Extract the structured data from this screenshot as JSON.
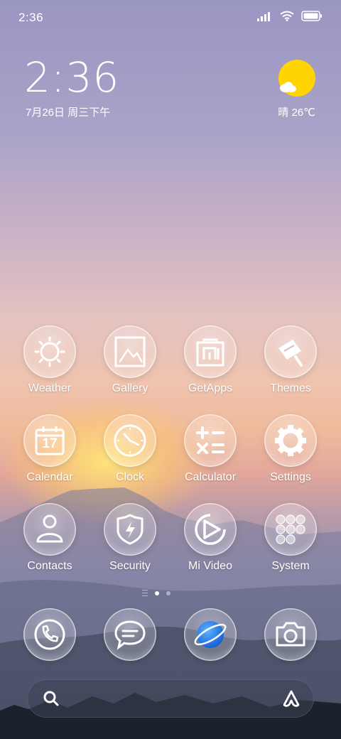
{
  "status_bar": {
    "time": "2:36"
  },
  "clock_widget": {
    "time": "2:36",
    "date": "7月26日 周三下午",
    "weather": "晴 26℃"
  },
  "apps": [
    {
      "label": "Weather",
      "icon": "sun-icon"
    },
    {
      "label": "Gallery",
      "icon": "picture-icon"
    },
    {
      "label": "GetApps",
      "icon": "shopping-bag-icon"
    },
    {
      "label": "Themes",
      "icon": "paint-roller-icon"
    },
    {
      "label": "Calendar",
      "icon": "calendar-icon",
      "day": "17"
    },
    {
      "label": "Clock",
      "icon": "clock-icon"
    },
    {
      "label": "Calculator",
      "icon": "calculator-icon"
    },
    {
      "label": "Settings",
      "icon": "gear-icon"
    },
    {
      "label": "Contacts",
      "icon": "person-icon"
    },
    {
      "label": "Security",
      "icon": "shield-icon"
    },
    {
      "label": "Mi Video",
      "icon": "play-icon"
    },
    {
      "label": "System",
      "icon": "folder-icon"
    }
  ],
  "dock": [
    {
      "icon": "phone-icon"
    },
    {
      "icon": "message-icon"
    },
    {
      "icon": "browser-icon"
    },
    {
      "icon": "camera-icon"
    }
  ],
  "page_indicator": {
    "pages": 2,
    "current": 1
  },
  "search_bar": {
    "placeholder": ""
  },
  "colors": {
    "sun": "#ffd400",
    "browser": "#1f7fe6"
  }
}
